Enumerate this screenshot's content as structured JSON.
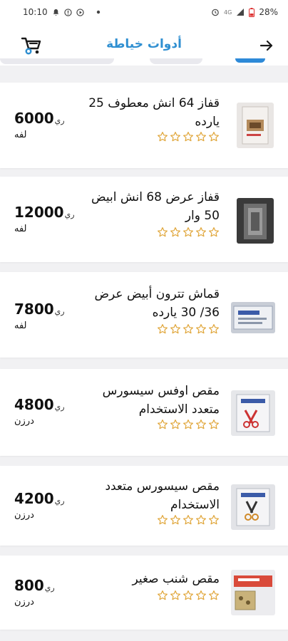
{
  "status": {
    "time": "10:10",
    "battery": "28%",
    "network": "4G"
  },
  "header": {
    "title": "أدوات خياطة"
  },
  "colors": {
    "accent": "#2f8fd1",
    "star": "#e0a63a",
    "background": "#f1f1f3"
  },
  "products": [
    {
      "name": "قفاز 64 انش معطوف 25 يارده",
      "price": "6000",
      "currency": "ري",
      "unit": "لفه",
      "rating": 0
    },
    {
      "name": "قفاز عرض 68  انش  ابيض 50 وار",
      "price": "12000",
      "currency": "ري",
      "unit": "لفه",
      "rating": 0
    },
    {
      "name": "قماش تترون أبيض عرض 36/ 30 يارده",
      "price": "7800",
      "currency": "ري",
      "unit": "لفه",
      "rating": 0
    },
    {
      "name": "مقص اوفس سيسورس متعدد الاستخدام",
      "price": "4800",
      "currency": "ري",
      "unit": "درزن",
      "rating": 0
    },
    {
      "name": "مقص سيسورس متعدد الاستخدام",
      "price": "4200",
      "currency": "ري",
      "unit": "درزن",
      "rating": 0
    },
    {
      "name": "مقص شنب صغير",
      "price": "800",
      "currency": "ري",
      "unit": "درزن",
      "rating": 0
    }
  ]
}
